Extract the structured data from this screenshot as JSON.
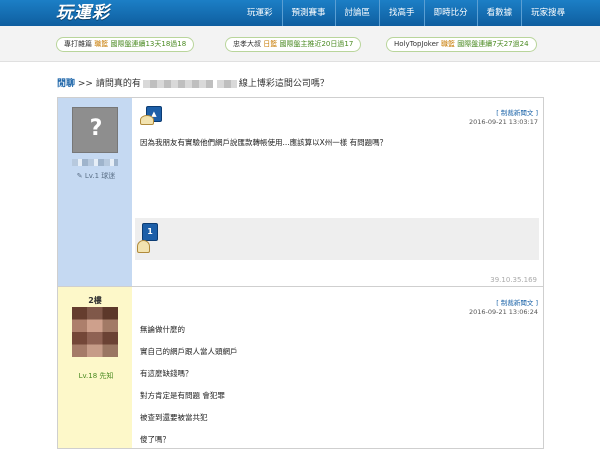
{
  "header": {
    "logo": "玩運彩",
    "nav": [
      "玩運彩",
      "預測賽事",
      "討論區",
      "找高手",
      "即時比分",
      "看數據",
      "玩家搜尋"
    ]
  },
  "ticker": [
    {
      "user": "專打雜篇",
      "tag": "職籃",
      "text": "國際盤連續13天18過18"
    },
    {
      "user": "忠孝大叔",
      "tag": "日籃",
      "text": "國際盤主推近20日過17"
    },
    {
      "user": "HolyTopJoker",
      "tag": "職籃",
      "text": "國際盤連續7天27過24"
    }
  ],
  "breadcrumb": {
    "home": "閒聊",
    "sep": ">>",
    "title_start": "請問真的有",
    "title_end": "線上博彩這間公司嗎？"
  },
  "posts": [
    {
      "avatar_glyph": "?",
      "level": "✎ Lv.1 球迷",
      "badge_label": "1",
      "report": "[ 制裁新聞文 ]",
      "time": "2016-09-21 13:03:17",
      "body": "因為我朋友有實驗他們網戶說匯款轉帳使用...應該算以X州一樣 有問題嗎？",
      "ip": "39.10.35.169"
    },
    {
      "floor": "2樓",
      "level": "Lv.18 先知",
      "report": "[ 制裁新聞文 ]",
      "time": "2016-09-21 13:06:24",
      "lines": [
        "無論做什麼的",
        "實自己的網戶跟人當人頭網戶",
        "有這麼缺錢嗎？",
        "對方肯定是有問題 會犯罪",
        "被查到還要被當共犯",
        "傻了嗎？"
      ]
    }
  ]
}
